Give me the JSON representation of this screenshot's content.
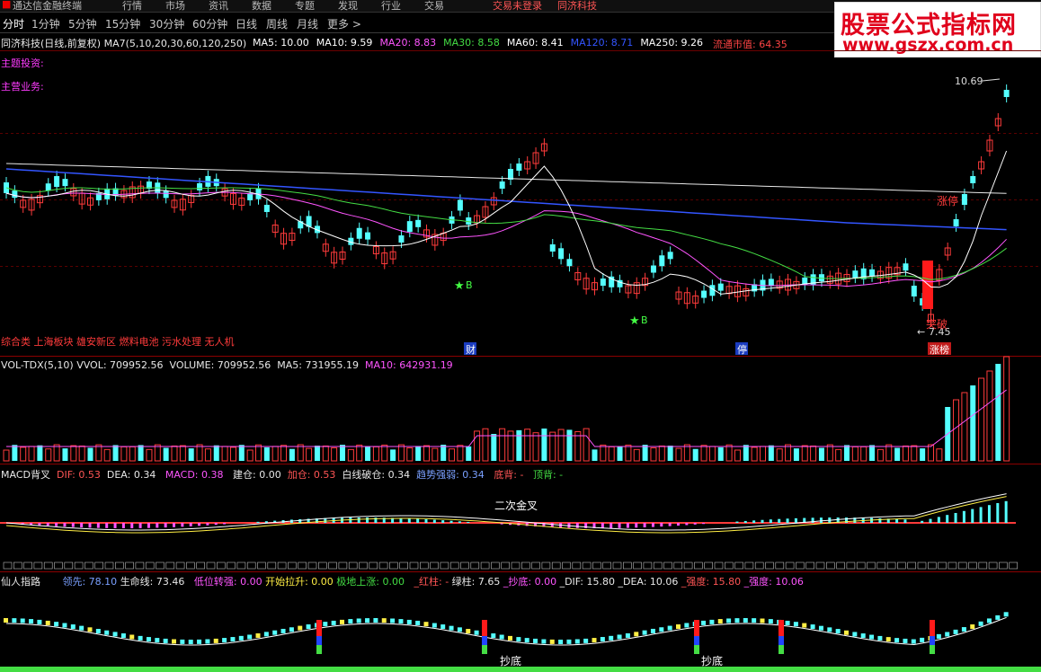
{
  "menubar": {
    "app_title": "通达信金融终端",
    "items": [
      "行情",
      "市场",
      "资讯",
      "数据",
      "专题",
      "发现",
      "行业",
      "交易"
    ],
    "status": "交易未登录",
    "stock_name": "同济科技"
  },
  "tabs": [
    "分时",
    "1分钟",
    "5分钟",
    "15分钟",
    "30分钟",
    "60分钟",
    "日线",
    "周线",
    "月线",
    "更多 >"
  ],
  "main": {
    "title": "同济科技(日线,前复权) MA7(5,10,20,30,60,120,250)",
    "ma": [
      {
        "label": "MA5: 10.00",
        "color": "#ffffff"
      },
      {
        "label": "MA10: 9.59",
        "color": "#ffffff"
      },
      {
        "label": "MA20: 8.83",
        "color": "#ff55ff"
      },
      {
        "label": "MA30: 8.58",
        "color": "#44dd44"
      },
      {
        "label": "MA60: 8.41",
        "color": "#ffffff"
      },
      {
        "label": "MA120: 8.71",
        "color": "#3355ff"
      },
      {
        "label": "MA250: 9.26",
        "color": "#ffffff"
      }
    ],
    "market_value": "流通市值: 64.35",
    "theme_label": "主题投资:",
    "business_label": "主营业务:",
    "concepts": "综合类 上海板块 雄安新区 燃料电池 污水处理 无人机",
    "high_label": "10.69",
    "low_label": "7.45",
    "zhangting": "涨停",
    "break_label": "突破",
    "markers": {
      "cai": "财",
      "ting": "停",
      "zhangbang": "涨榜"
    },
    "buy_signal": "B"
  },
  "volume": {
    "title": "VOL-TDX(5,10)",
    "vvol": "VVOL: 709952.56",
    "vol": "VOLUME: 709952.56",
    "ma5": "MA5: 731955.19",
    "ma10": "MA10: 642931.19"
  },
  "macd": {
    "title": "MACD背叉",
    "dif": "DIF: 0.53",
    "dea": "DEA: 0.34",
    "macd": "MACD: 0.38",
    "jiancang": "建仓: 0.00",
    "jiacang": "加仓: 0.53",
    "riqian": "白线破仓: 0.34",
    "qushi": "趋势强弱: 0.34",
    "dibei": "底背: -",
    "dingbei": "顶背: -",
    "annotation": "二次金叉"
  },
  "xianren": {
    "title": "仙人指路",
    "lingxian": "领先: 78.10",
    "shengming": "生命线: 73.46",
    "diwei": "低位转强: 0.00",
    "kaishi": "开始拉升: 0.00",
    "jidi": "极地上涨: 0.00",
    "hongzhu": "_红柱: -",
    "lvzhu": "绿柱: 7.65",
    "chaodi": "_抄底: 0.00",
    "dif": "_DIF: 15.80",
    "dea": "_DEA: 10.06",
    "qiangdu": "_强度: 15.80",
    "qiangdu2": "_强度: 10.06",
    "chaodi_label": "抄底"
  },
  "logo": {
    "line1": "股票公式指标网",
    "line2": "www.gszx.com.cn"
  },
  "colors": {
    "up": "#ff3b3b",
    "down": "#54ffff",
    "ma20": "#ff55ff",
    "ma30": "#44dd44",
    "ma120": "#3355ff",
    "grid": "#8b0000"
  }
}
